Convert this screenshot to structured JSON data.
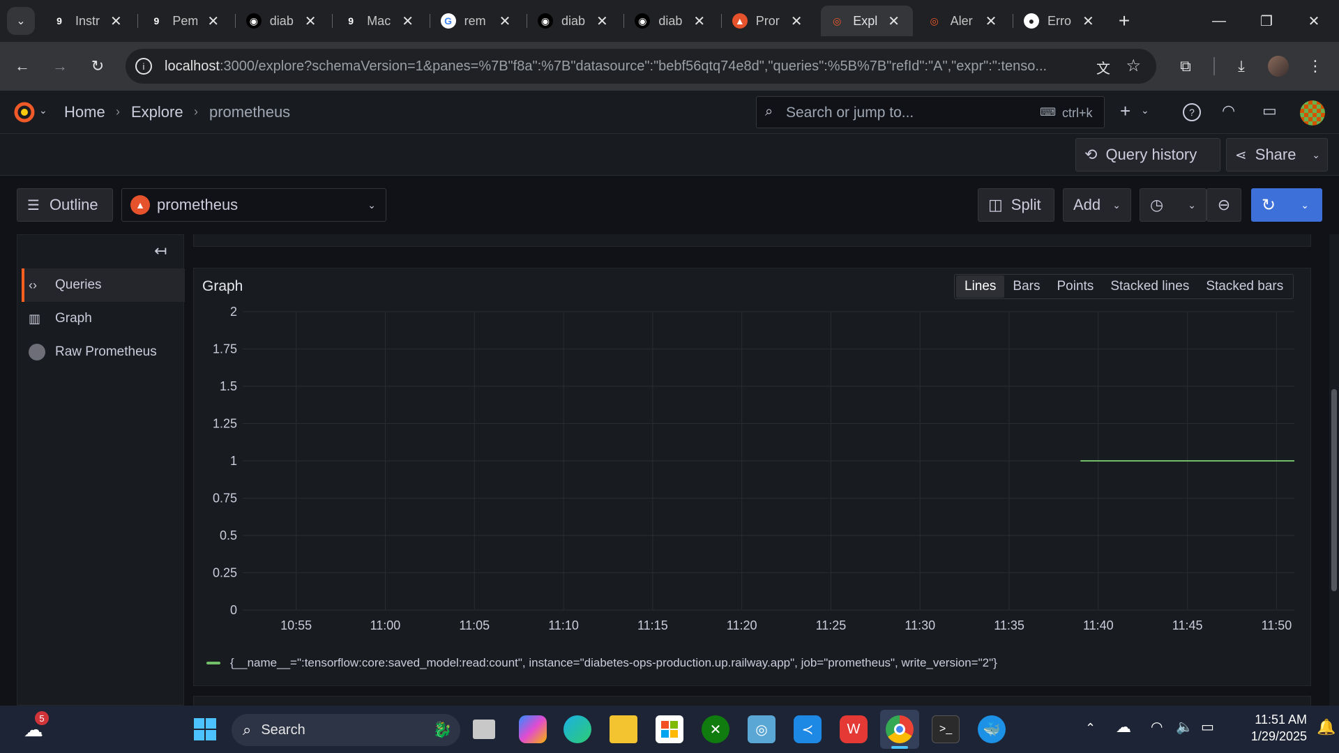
{
  "browser": {
    "tabs": [
      {
        "title": "Instr",
        "icon": "g9"
      },
      {
        "title": "Pem",
        "icon": "g9"
      },
      {
        "title": "diab",
        "icon": "globe"
      },
      {
        "title": "Mac",
        "icon": "g9"
      },
      {
        "title": "rem",
        "icon": "google"
      },
      {
        "title": "diab",
        "icon": "globe"
      },
      {
        "title": "diab",
        "icon": "globe"
      },
      {
        "title": "Pror",
        "icon": "prometheus"
      },
      {
        "title": "Expl",
        "icon": "grafana",
        "active": true
      },
      {
        "title": "Aler",
        "icon": "grafana"
      },
      {
        "title": "Erro",
        "icon": "github"
      }
    ],
    "url_host": "localhost",
    "url_rest": ":3000/explore?schemaVersion=1&panes=%7B\"f8a\":%7B\"datasource\":\"bebf56qtq74e8d\",\"queries\":%5B%7B\"refId\":\"A\",\"expr\":\":tenso..."
  },
  "grafana": {
    "breadcrumb": [
      "Home",
      "Explore",
      "prometheus"
    ],
    "search_placeholder": "Search or jump to...",
    "search_shortcut": "ctrl+k",
    "query_history_label": "Query history",
    "share_label": "Share",
    "outline_label": "Outline",
    "datasource": "prometheus",
    "split_label": "Split",
    "add_label": "Add",
    "outline_items": [
      "Queries",
      "Graph",
      "Raw Prometheus"
    ]
  },
  "graph": {
    "title": "Graph",
    "viz_options": [
      "Lines",
      "Bars",
      "Points",
      "Stacked lines",
      "Stacked bars"
    ],
    "selected_viz": "Lines",
    "legend": "{__name__=\":tensorflow:core:saved_model:read:count\", instance=\"diabetes-ops-production.up.railway.app\", job=\"prometheus\", write_version=\"2\"}",
    "series_color": "#73bf69"
  },
  "chart_data": {
    "type": "line",
    "y_ticks": [
      "2",
      "1.75",
      "1.5",
      "1.25",
      "1",
      "0.75",
      "0.5",
      "0.25",
      "0"
    ],
    "x_ticks": [
      "10:55",
      "11:00",
      "11:05",
      "11:10",
      "11:15",
      "11:20",
      "11:25",
      "11:30",
      "11:35",
      "11:40",
      "11:45",
      "11:50"
    ],
    "ylim": [
      0,
      2
    ],
    "xlim": [
      "10:52",
      "11:51"
    ],
    "series": [
      {
        "x": [
          "11:39",
          "11:51"
        ],
        "values": [
          1,
          1
        ]
      }
    ]
  },
  "taskbar": {
    "search_label": "Search",
    "time": "11:51 AM",
    "date": "1/29/2025",
    "weather_badge": "5"
  }
}
